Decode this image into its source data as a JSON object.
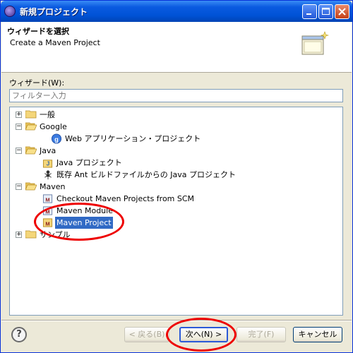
{
  "window": {
    "title": "新規プロジェクト"
  },
  "header": {
    "title": "ウィザードを選択",
    "description": "Create a Maven Project"
  },
  "wizard_label": "ウィザード(W):",
  "filter": {
    "placeholder": "フィルター入力"
  },
  "tree": {
    "general": "一般",
    "google": "Google",
    "google_web": "Web アプリケーション・プロジェクト",
    "java": "Java",
    "java_project": "Java プロジェクト",
    "java_existing": "既存 Ant ビルドファイルからの Java プロジェクト",
    "maven": "Maven",
    "maven_checkout": "Checkout Maven Projects from SCM",
    "maven_module": "Maven Module",
    "maven_project": "Maven Project",
    "samples": "サンプル"
  },
  "buttons": {
    "back": "< 戻る(B)",
    "next": "次へ(N) >",
    "finish": "完了(F)",
    "cancel": "キャンセル",
    "help": "?"
  },
  "colors": {
    "selection": "#316ac5",
    "annotation": "#e00000",
    "titlebar": "#0052d6"
  }
}
